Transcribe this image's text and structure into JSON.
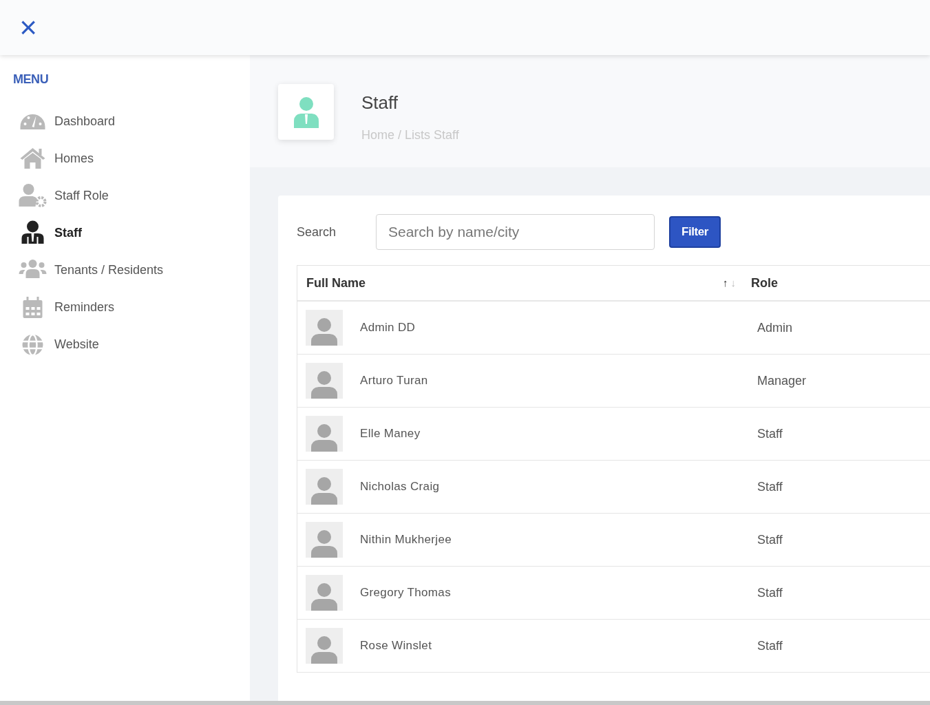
{
  "close_button": "×",
  "sidebar": {
    "heading": "MENU",
    "items": [
      {
        "label": "Dashboard",
        "selected": false
      },
      {
        "label": "Homes",
        "selected": false
      },
      {
        "label": "Staff Role",
        "selected": false
      },
      {
        "label": "Staff",
        "selected": true
      },
      {
        "label": "Tenants / Residents",
        "selected": false
      },
      {
        "label": "Reminders",
        "selected": false
      },
      {
        "label": "Website",
        "selected": false
      }
    ]
  },
  "page_header": {
    "title": "Staff",
    "breadcrumb": "Home / Lists Staff"
  },
  "search": {
    "label": "Search",
    "placeholder": "Search by name/city",
    "button": "Filter"
  },
  "table": {
    "columns": [
      {
        "label": "Full Name",
        "sort_up": "↑",
        "sort_down": "↓"
      },
      {
        "label": "Role"
      }
    ],
    "rows": [
      {
        "name": "Admin DD",
        "role": "Admin"
      },
      {
        "name": "Arturo Turan",
        "role": "Manager"
      },
      {
        "name": "Elle Maney",
        "role": "Staff"
      },
      {
        "name": "Nicholas Craig",
        "role": "Staff"
      },
      {
        "name": "Nithin Mukherjee",
        "role": "Staff"
      },
      {
        "name": "Gregory Thomas",
        "role": "Staff"
      },
      {
        "name": "Rose Winslet",
        "role": "Staff"
      }
    ]
  }
}
